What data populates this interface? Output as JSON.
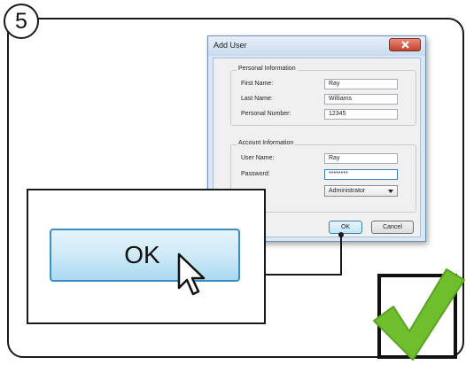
{
  "step": {
    "number": "5"
  },
  "dialog": {
    "title": "Add User",
    "close_icon": "close-icon",
    "personal": {
      "legend": "Personal Information",
      "first_name_label": "First Name:",
      "first_name_value": "Ray",
      "last_name_label": "Last Name:",
      "last_name_value": "Williams",
      "personal_number_label": "Personal Number:",
      "personal_number_value": "12345"
    },
    "account": {
      "legend": "Account Information",
      "user_name_label": "User Name:",
      "user_name_value": "Ray",
      "password_label": "Password:",
      "password_value": "********",
      "role_value": "Administrator"
    },
    "ok_label": "OK",
    "cancel_label": "Cancel"
  },
  "callout": {
    "ok_label": "OK",
    "cursor_icon": "hand-cursor-icon"
  },
  "check": {
    "icon": "green-checkmark-icon",
    "color": "#6fbe2d"
  }
}
